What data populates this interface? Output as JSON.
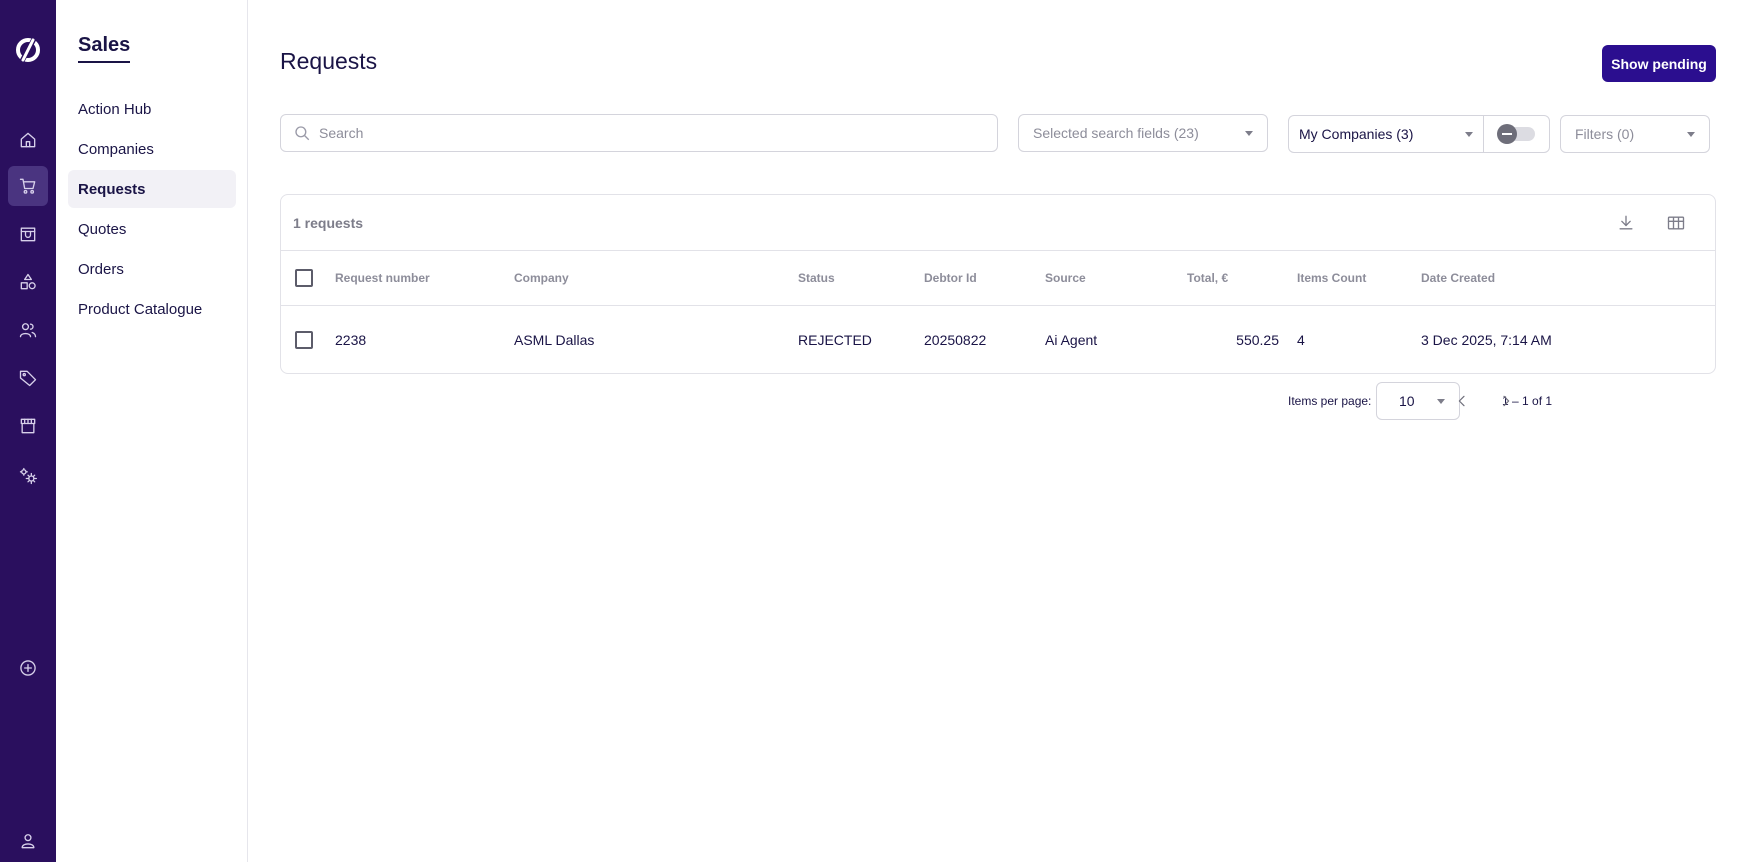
{
  "app": {
    "section_title": "Sales",
    "brand_color": "#2a0f5e",
    "accent_color": "#2b0e8f"
  },
  "rail": {
    "icons": [
      "logo-icon",
      "home-icon",
      "cart-icon",
      "store-icon",
      "shapes-icon",
      "users-icon",
      "tag-icon",
      "shop-icon",
      "settings-icon",
      "add-circle-icon",
      "user-icon"
    ],
    "active": "cart-icon"
  },
  "sidebar": {
    "items": [
      {
        "label": "Action Hub"
      },
      {
        "label": "Companies"
      },
      {
        "label": "Requests"
      },
      {
        "label": "Quotes"
      },
      {
        "label": "Orders"
      },
      {
        "label": "Product Catalogue"
      }
    ],
    "active_index": 2
  },
  "page": {
    "title": "Requests",
    "primary_button": "Show pending"
  },
  "filters": {
    "search_placeholder": "Search",
    "search_value": "",
    "search_fields": "Selected search fields (23)",
    "companies": "My Companies (3)",
    "filters": "Filters (0)",
    "toggle_on": false
  },
  "table": {
    "count_label": "1 requests",
    "columns": [
      "Request number",
      "Company",
      "Status",
      "Debtor Id",
      "Source",
      "Total, €",
      "Items Count",
      "Date Created"
    ],
    "rows": [
      [
        "2238",
        "ASML Dallas",
        "REJECTED",
        "20250822",
        "Ai Agent",
        "550.25",
        "4",
        "3 Dec 2025, 7:14 AM"
      ]
    ]
  },
  "pagination": {
    "items_per_page_label": "Items per page:",
    "items_per_page": "10",
    "range": "1 – 1 of 1"
  }
}
